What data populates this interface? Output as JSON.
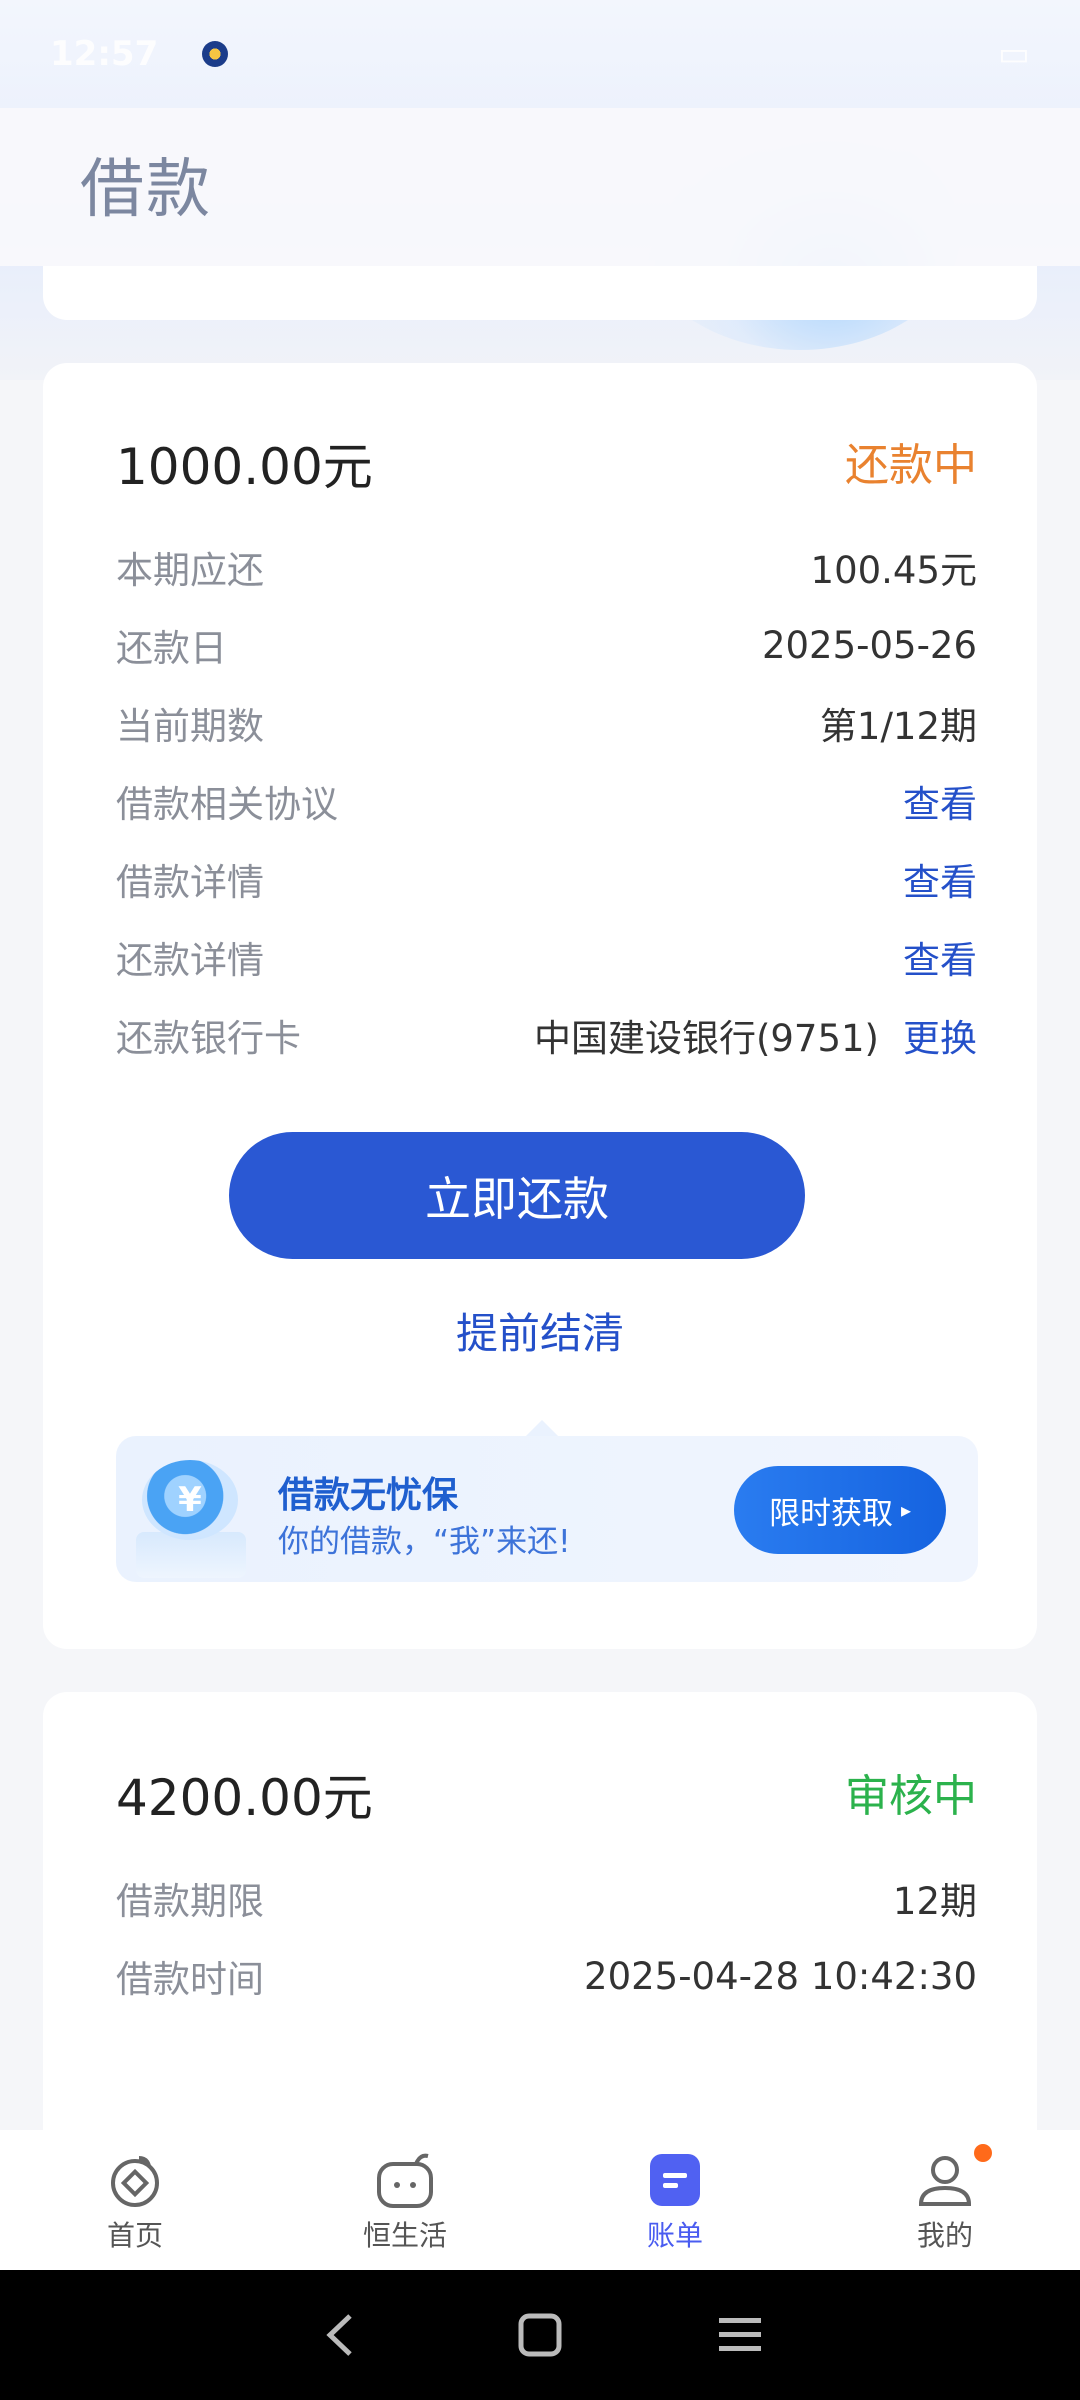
{
  "status_bar": {
    "time": "12:57",
    "sys_text": ""
  },
  "header": {
    "title": "借款"
  },
  "loans": [
    {
      "amount": "1000.00元",
      "status": "还款中",
      "status_color": "#e9822f",
      "rows": [
        {
          "label": "本期应还",
          "value": "100.45元"
        },
        {
          "label": "还款日",
          "value": "2025-05-26"
        },
        {
          "label": "当前期数",
          "value": "第1/12期"
        },
        {
          "label": "借款相关协议",
          "link": "查看"
        },
        {
          "label": "借款详情",
          "link": "查看"
        },
        {
          "label": "还款详情",
          "link": "查看"
        },
        {
          "label": "还款银行卡",
          "value": "中国建设银行(9751)",
          "link": "更换"
        }
      ],
      "primary_button": "立即还款",
      "secondary_link": "提前结清",
      "promo": {
        "title": "借款无忧保",
        "subtitle": "你的借款，“我”来还!",
        "button": "限时获取",
        "coin_symbol": "¥"
      }
    },
    {
      "amount": "4200.00元",
      "status": "审核中",
      "status_color": "#2bb24c",
      "rows": [
        {
          "label": "借款期限",
          "value": "12期"
        },
        {
          "label": "借款时间",
          "value": "2025-04-28 10:42:30"
        }
      ]
    }
  ],
  "tabbar": {
    "items": [
      {
        "label": "首页",
        "icon": "home-icon"
      },
      {
        "label": "恒生活",
        "icon": "life-icon"
      },
      {
        "label": "账单",
        "icon": "bill-icon",
        "active": true
      },
      {
        "label": "我的",
        "icon": "profile-icon",
        "badge": true
      }
    ]
  },
  "colors": {
    "primary": "#2a58d3",
    "link": "#2450c9",
    "status_repaying": "#e9822f",
    "status_reviewing": "#2bb24c",
    "tab_active": "#4a5cf0"
  }
}
